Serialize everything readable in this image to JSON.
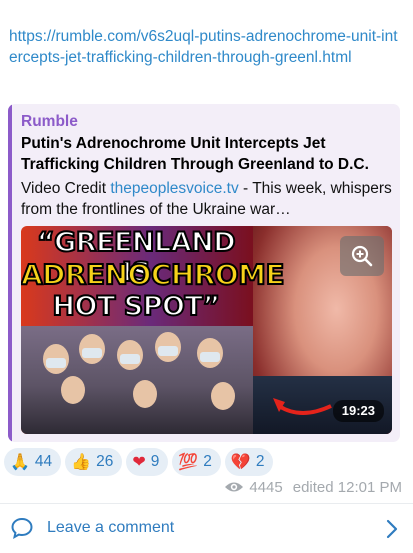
{
  "message": {
    "link_text": "https://rumble.com/v6s2uql-putins-adrenochrome-unit-intercepts-jet-trafficking-children-through-greenl.html"
  },
  "preview": {
    "site": "Rumble",
    "title": "Putin's Adrenochrome Unit Intercepts Jet Trafficking Children Through Greenland to D.C.",
    "desc_prefix": "Video Credit ",
    "desc_link": "thepeoplesvoice.tv",
    "desc_suffix": " - This week, whispers from the frontlines of the Ukraine war…",
    "thumbnail_lines": [
      "“GREENLAND IS",
      "ADRENOCHROME",
      "HOT SPOT”"
    ],
    "duration": "19:23",
    "zoom_icon": "zoom-in-icon"
  },
  "reactions": [
    {
      "emoji": "🙏",
      "count": "44"
    },
    {
      "emoji": "👍",
      "count": "26"
    },
    {
      "emoji": "❤",
      "count": "9"
    },
    {
      "emoji": "💯",
      "count": "2"
    },
    {
      "emoji": "💔",
      "count": "2"
    }
  ],
  "meta": {
    "views": "4445",
    "edited": "edited 12:01 PM"
  },
  "footer": {
    "comment_label": "Leave a comment"
  },
  "colors": {
    "link": "#2f89c9",
    "accent": "#8c5bc9",
    "reaction_bg": "#e6eef6"
  }
}
